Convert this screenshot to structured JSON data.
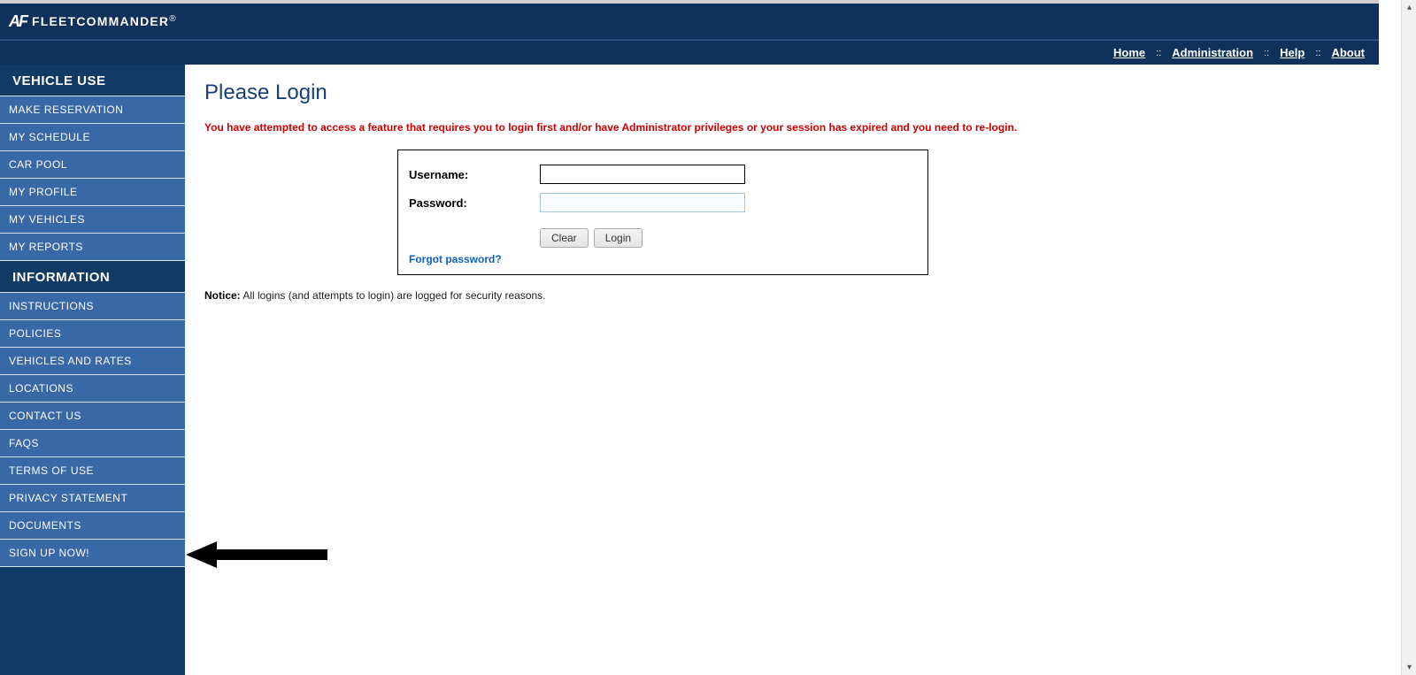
{
  "brand": {
    "icon": "AF",
    "name": "FLEETCOMMANDER"
  },
  "topnav": {
    "home": "Home",
    "administration": "Administration",
    "help": "Help",
    "about": "About",
    "sep": "::"
  },
  "sidebar": {
    "vehicle_use_heading": "VEHICLE USE",
    "information_heading": "INFORMATION",
    "vehicle_items": [
      "MAKE RESERVATION",
      "MY SCHEDULE",
      "CAR POOL",
      "MY PROFILE",
      "MY VEHICLES",
      "MY REPORTS"
    ],
    "information_items": [
      "INSTRUCTIONS",
      "POLICIES",
      "VEHICLES AND RATES",
      "LOCATIONS",
      "CONTACT US",
      "FAQS",
      "TERMS OF USE",
      "PRIVACY STATEMENT",
      "DOCUMENTS",
      "SIGN UP NOW!"
    ]
  },
  "main": {
    "title": "Please Login",
    "error": "You have attempted to access a feature that requires you to login first and/or have Administrator privileges or your session has expired and you need to re-login.",
    "username_label": "Username:",
    "password_label": "Password:",
    "username_value": "",
    "password_value": "",
    "clear_btn": "Clear",
    "login_btn": "Login",
    "forgot": "Forgot password?",
    "notice_label": "Notice:",
    "notice_text": " All logins (and attempts to login) are logged for security reasons."
  }
}
